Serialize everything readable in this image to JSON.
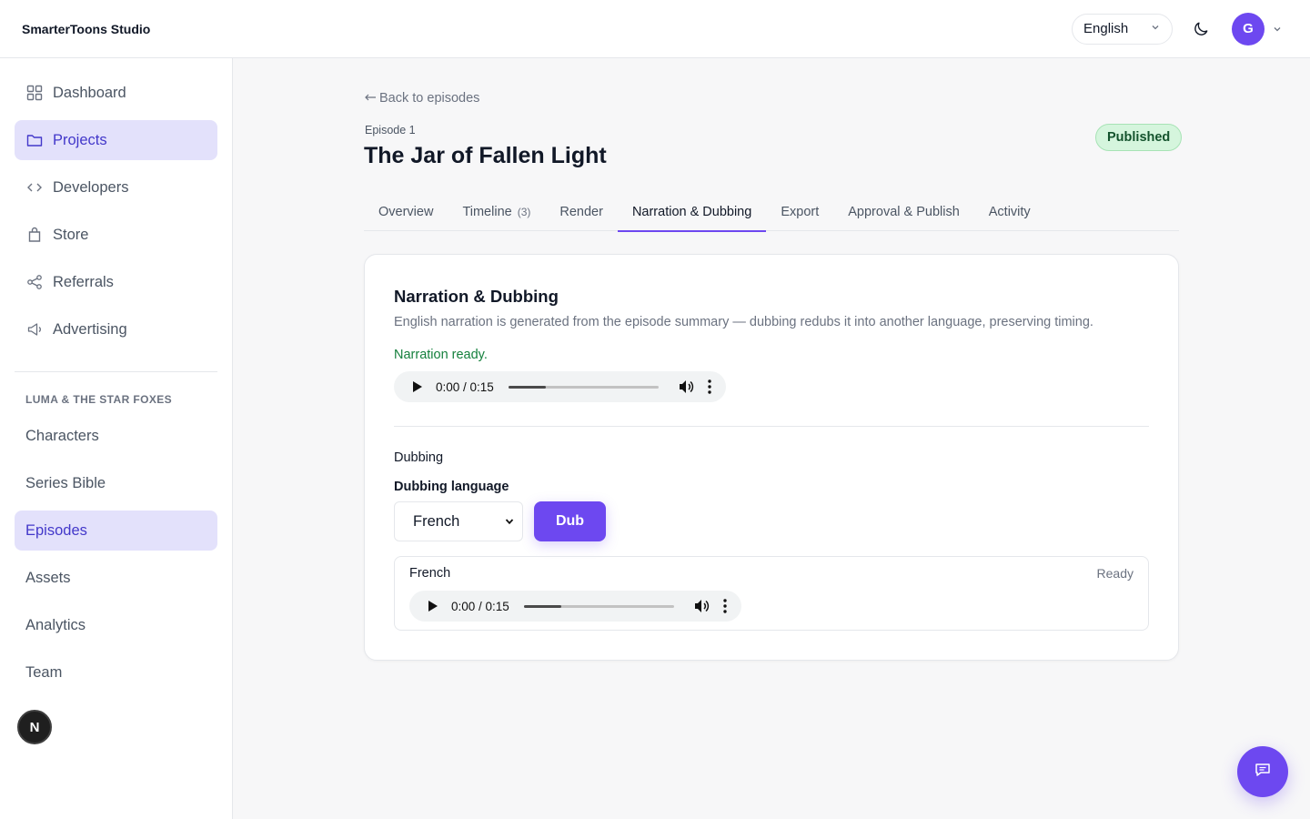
{
  "brand": "SmarterToons Studio",
  "header": {
    "language_selected": "English",
    "avatar_initial": "G"
  },
  "sidebar": {
    "items": [
      {
        "label": "Dashboard",
        "icon": "grid-icon"
      },
      {
        "label": "Projects",
        "icon": "folder-icon",
        "active": true
      },
      {
        "label": "Developers",
        "icon": "code-icon"
      },
      {
        "label": "Store",
        "icon": "bag-icon"
      },
      {
        "label": "Referrals",
        "icon": "share-icon"
      },
      {
        "label": "Advertising",
        "icon": "megaphone-icon"
      }
    ],
    "section_label": "LUMA & THE STAR FOXES",
    "project_items": [
      {
        "label": "Characters"
      },
      {
        "label": "Series Bible"
      },
      {
        "label": "Episodes",
        "active": true
      },
      {
        "label": "Assets"
      },
      {
        "label": "Analytics"
      },
      {
        "label": "Team"
      }
    ],
    "badge": "N"
  },
  "page": {
    "back_link": "Back to episodes",
    "episode_label": "Episode 1",
    "title": "The Jar of Fallen Light",
    "status_badge": "Published"
  },
  "tabs": [
    {
      "label": "Overview"
    },
    {
      "label": "Timeline",
      "count": "(3)"
    },
    {
      "label": "Render"
    },
    {
      "label": "Narration & Dubbing",
      "active": true
    },
    {
      "label": "Export"
    },
    {
      "label": "Approval & Publish"
    },
    {
      "label": "Activity"
    }
  ],
  "narration": {
    "title": "Narration & Dubbing",
    "description": "English narration is generated from the episode summary — dubbing redubs it into another language, preserving timing.",
    "status": "Narration ready.",
    "player": {
      "time": "0:00 / 0:15",
      "buffered_fraction": 0.25
    }
  },
  "dubbing": {
    "heading": "Dubbing",
    "language_label": "Dubbing language",
    "selected_language": "French",
    "button_label": "Dub",
    "result": {
      "language": "French",
      "status": "Ready",
      "player": {
        "time": "0:00 / 0:15",
        "buffered_fraction": 0.25
      }
    }
  },
  "colors": {
    "accent": "#6d48f0",
    "active_nav_bg": "#e3e1fb",
    "success": "#15803d",
    "published_bg": "#d5f5dd"
  }
}
